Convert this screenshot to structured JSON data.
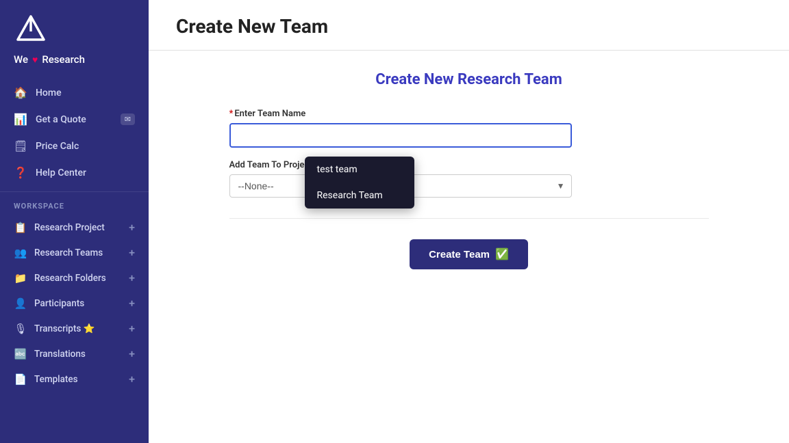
{
  "sidebar": {
    "brand": "We",
    "brandHeart": "♥",
    "brandSuffix": "Research",
    "nav": [
      {
        "id": "home",
        "label": "Home",
        "icon": "🏠"
      },
      {
        "id": "get-a-quote",
        "label": "Get a Quote",
        "icon": "📊",
        "badge": "✉"
      },
      {
        "id": "price-calc",
        "label": "Price Calc",
        "icon": "🗒"
      },
      {
        "id": "help-center",
        "label": "Help Center",
        "icon": "❓"
      }
    ],
    "workspace_label": "WORKSPACE",
    "workspace_items": [
      {
        "id": "research-project",
        "label": "Research Project",
        "icon": "📋"
      },
      {
        "id": "research-teams",
        "label": "Research Teams",
        "icon": "👥"
      },
      {
        "id": "research-folders",
        "label": "Research Folders",
        "icon": "📁"
      },
      {
        "id": "participants",
        "label": "Participants",
        "icon": "👤"
      },
      {
        "id": "transcripts",
        "label": "Transcripts ⭐",
        "icon": "🎙"
      },
      {
        "id": "translations",
        "label": "Translations",
        "icon": "🔤"
      },
      {
        "id": "templates",
        "label": "Templates",
        "icon": "📄"
      }
    ]
  },
  "page": {
    "title": "Create New Team",
    "form_heading": "Create New Research Team",
    "team_name_label": "Enter Team Name",
    "team_name_required": "*",
    "team_name_placeholder": "",
    "add_team_label": "Add Team To Project",
    "select_default": "--None--",
    "autocomplete_items": [
      {
        "id": "test-team",
        "label": "test team"
      },
      {
        "id": "research-team",
        "label": "Research Team"
      }
    ],
    "create_btn_label": "Create Team",
    "check_symbol": "✅"
  }
}
